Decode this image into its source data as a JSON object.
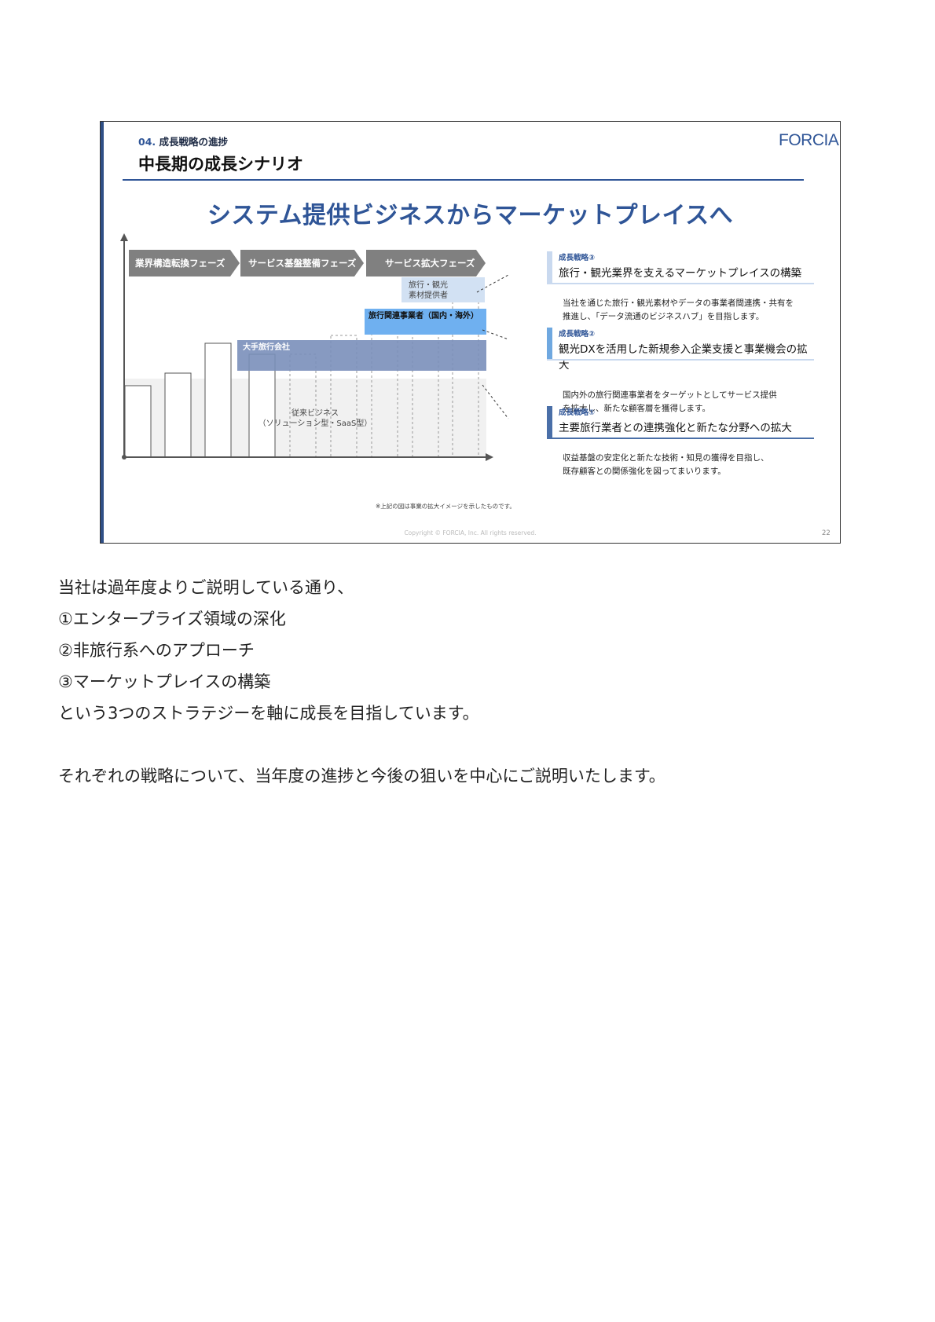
{
  "slide": {
    "section_number": "04.",
    "section_label": "成長戦略の進捗",
    "title": "中長期の成長シナリオ",
    "logo": "FORCIA",
    "headline": "システム提供ビジネスからマーケットプレイスへ",
    "phases": [
      "業界構造転換フェーズ",
      "サービス基盤整備フェーズ",
      "サービス拡大フェーズ"
    ],
    "layers": {
      "travel_materials": [
        "旅行・観光",
        "素材提供者"
      ],
      "travel_related": "旅行関連事業者（国内・海外）",
      "major_agency": "大手旅行会社",
      "legacy": [
        "従来ビジネス",
        "（ソリューション型・SaaS型）"
      ]
    },
    "footnote": "※上記の図は事業の拡大イメージを示したものです。",
    "copyright": "Copyright © FORCIA, Inc. All rights reserved.",
    "page_number": "22",
    "strategies": [
      {
        "label": "成長戦略③",
        "title": "旅行・観光業界を支えるマーケットプレイスの構築",
        "desc": [
          "当社を通じた旅行・観光素材やデータの事業者間連携・共有を",
          "推進し、「データ流通のビジネスハブ」を目指します。"
        ],
        "color": "#c9d9ef"
      },
      {
        "label": "成長戦略②",
        "title": "観光DXを活用した新規参入企業支援と事業機会の拡大",
        "desc": [
          "国内外の旅行関連事業者をターゲットとしてサービス提供",
          "を拡大し、新たな顧客層を獲得します。"
        ],
        "color": "#6fa8e0"
      },
      {
        "label": "成長戦略①",
        "title": "主要旅行業者との連携強化と新たな分野への拡大",
        "desc": [
          "収益基盤の安定化と新たな技術・知見の獲得を目指し、",
          "既存顧客との関係強化を図ってまいります。"
        ],
        "color": "#4a6fa8"
      }
    ]
  },
  "body": {
    "lines": [
      "当社は過年度よりご説明している通り、",
      "①エンタープライズ領域の深化",
      "②非旅行系へのアプローチ",
      "③マーケットプレイスの構築",
      "という3つのストラテジーを軸に成長を目指しています。",
      "",
      "それぞれの戦略について、当年度の進捗と今後の狙いを中心にご説明いたします。"
    ]
  }
}
